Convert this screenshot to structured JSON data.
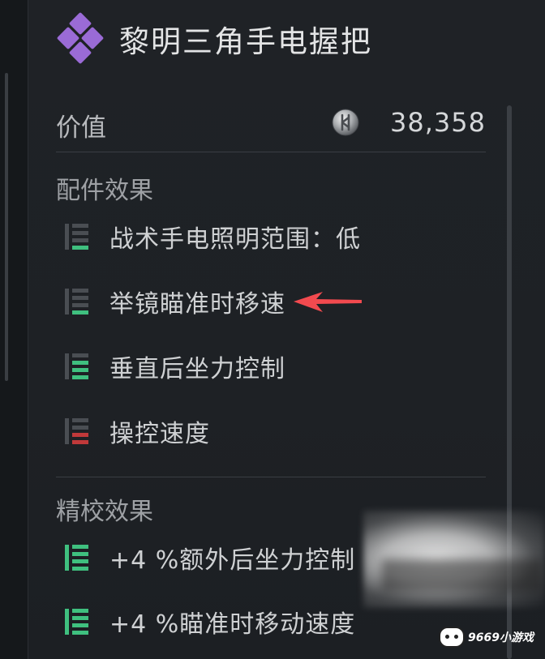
{
  "item": {
    "title": "黎明三角手电握把",
    "rarity_icon": "purple-diamond-cluster-icon",
    "rarity_color": "#9a6bd6"
  },
  "value": {
    "label": "价值",
    "amount": "38,358",
    "currency_icon": "silver-coin-icon"
  },
  "accessory_effects": {
    "title": "配件效果",
    "items": [
      {
        "text": "战术手电照明范围：低",
        "icon": "stat-bars-green-low-icon",
        "effect": "positive"
      },
      {
        "text": "举镜瞄准时移速",
        "icon": "stat-bars-green-low-icon",
        "effect": "positive"
      },
      {
        "text": "垂直后坐力控制",
        "icon": "stat-bars-green-full-icon",
        "effect": "positive"
      },
      {
        "text": "操控速度",
        "icon": "stat-bars-red-icon",
        "effect": "negative"
      }
    ]
  },
  "calibration_effects": {
    "title": "精校效果",
    "items": [
      {
        "text": "+4 %额外后坐力控制",
        "icon": "stat-bars-green-bright-icon"
      },
      {
        "text": "+4 %瞄准时移动速度",
        "icon": "stat-bars-green-bright-icon"
      }
    ]
  },
  "colors": {
    "positive": "#3fc07f",
    "negative": "#c0393a",
    "annotation_arrow": "#f24a4f"
  },
  "watermark": {
    "text": "9669小游戏"
  }
}
